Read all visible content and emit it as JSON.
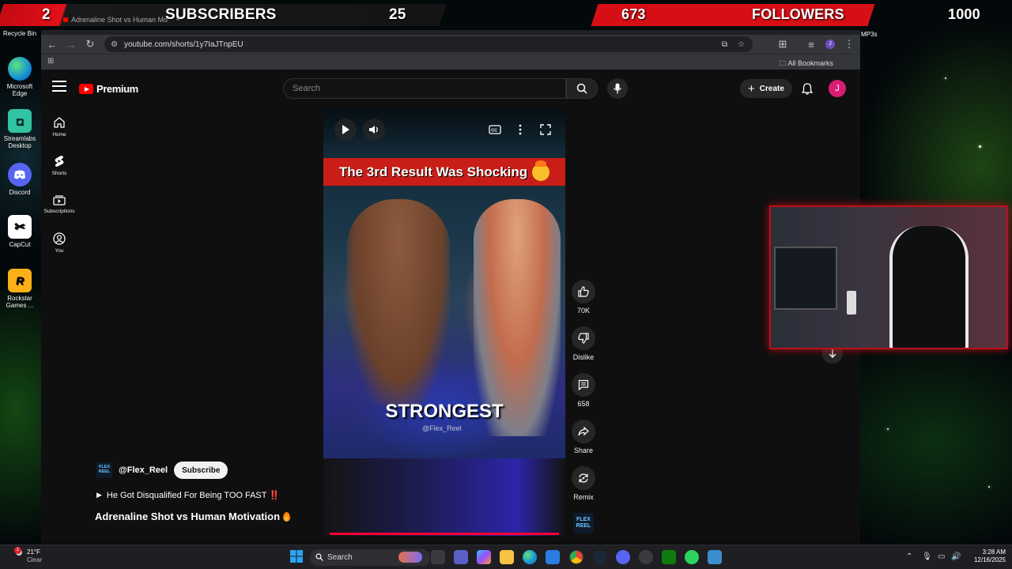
{
  "overlay": {
    "subscribers_current": "2",
    "subscribers_label": "SUBSCRIBERS",
    "subscribers_goal": "25",
    "followers_current": "673",
    "followers_label": "FOLLOWERS",
    "followers_goal": "1000",
    "accent_color": "#d60f16"
  },
  "desktop": {
    "icons": [
      {
        "label": "Recycle Bin",
        "icon": "recycle-bin-icon"
      },
      {
        "label": "Microsoft Edge",
        "icon": "edge-icon"
      },
      {
        "label": "Streamlabs Desktop",
        "icon": "streamlabs-icon"
      },
      {
        "label": "Discord",
        "icon": "discord-icon"
      },
      {
        "label": "CapCut",
        "icon": "capcut-icon"
      },
      {
        "label": "Rockstar Games ...",
        "icon": "rockstar-icon"
      }
    ],
    "right_partial_label": "MP3s"
  },
  "browser": {
    "tab_title": "Adrenaline Shot vs Human Mo",
    "url": "youtube.com/shorts/1y7IaJTnpEU",
    "bookmarks_label": "All Bookmarks"
  },
  "youtube": {
    "logo_text": "Premium",
    "search_placeholder": "Search",
    "create_label": "Create",
    "avatar_letter": "J",
    "nav": [
      {
        "label": "Home",
        "icon": "home-icon"
      },
      {
        "label": "Shorts",
        "icon": "shorts-icon"
      },
      {
        "label": "Subscriptions",
        "icon": "subscriptions-icon"
      },
      {
        "label": "You",
        "icon": "you-icon"
      }
    ],
    "video": {
      "banner_text": "The 3rd Result Was Shocking",
      "caption": "STRONGEST",
      "watermark": "@Flex_Reel",
      "progress": 1.0
    },
    "actions": {
      "likes": "70K",
      "dislike_label": "Dislike",
      "comments": "658",
      "share_label": "Share",
      "remix_label": "Remix",
      "channel_thumb": "FLEX REEL"
    },
    "channel": {
      "logo_text": "FLEX REEL",
      "handle": "@Flex_Reel",
      "subscribe_label": "Subscribe"
    },
    "description": "He Got Disqualified For Being TOO FAST ‼️",
    "title": "Adrenaline Shot vs Human Motivation"
  },
  "taskbar": {
    "weather_temp": "21°F",
    "weather_desc": "Clear",
    "notification_count": "1",
    "search_placeholder": "Search",
    "time": "3:28 AM",
    "date": "12/16/2025"
  }
}
